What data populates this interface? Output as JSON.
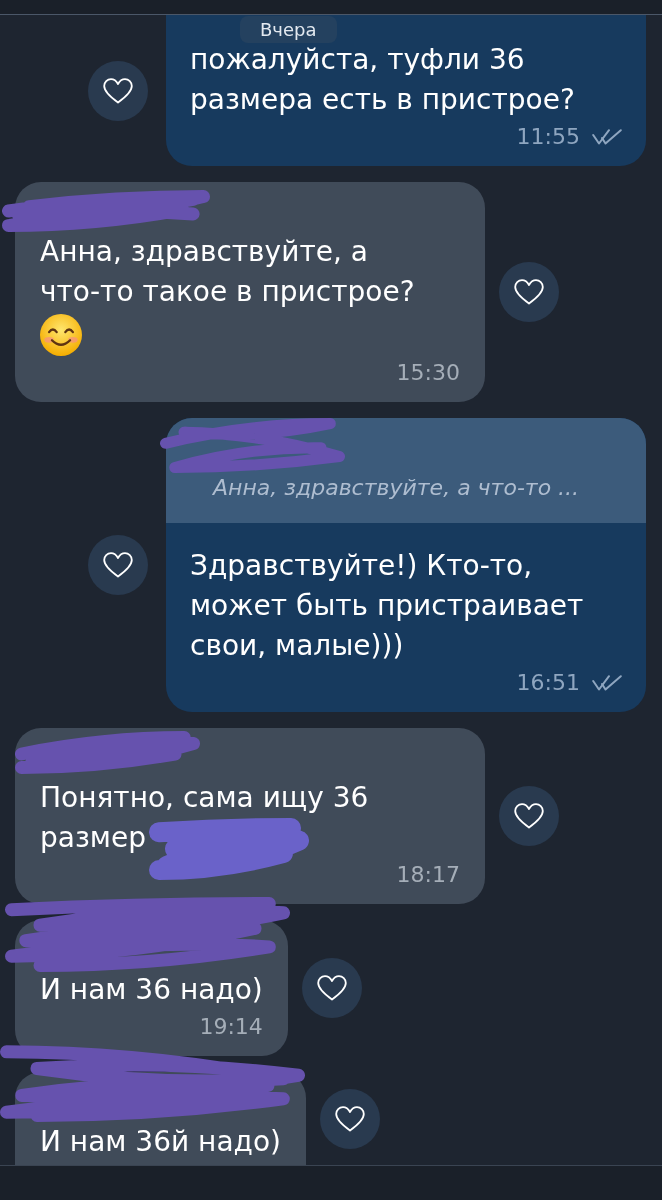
{
  "date_label": "Вчера",
  "messages": [
    {
      "kind": "outgoing",
      "text": "пожалуйста, туфли 36 размера есть в пристрое?",
      "time": "11:55",
      "read": true
    },
    {
      "kind": "incoming",
      "name_scribbled": true,
      "text": "Анна, здравствуйте, а что-то такое в пристрое?",
      "has_emoji": true,
      "time": "15:30"
    },
    {
      "kind": "outgoing",
      "reply": {
        "name_scribbled": true,
        "text": "Анна, здравствуйте, а что-то ..."
      },
      "text": "Здравствуйте!) Кто-то, может быть пристраивает свои, малые)))",
      "time": "16:51",
      "read": true
    },
    {
      "kind": "incoming",
      "name_scribbled": true,
      "text": "Понятно, сама ищу 36 размер",
      "text_scribbled": true,
      "time": "18:17"
    },
    {
      "kind": "incoming",
      "name_scribbled": true,
      "text": "И нам 36 надо)",
      "time": "19:14"
    },
    {
      "kind": "incoming",
      "name_scribbled": true,
      "text": "И нам 36й надо)"
    }
  ]
}
